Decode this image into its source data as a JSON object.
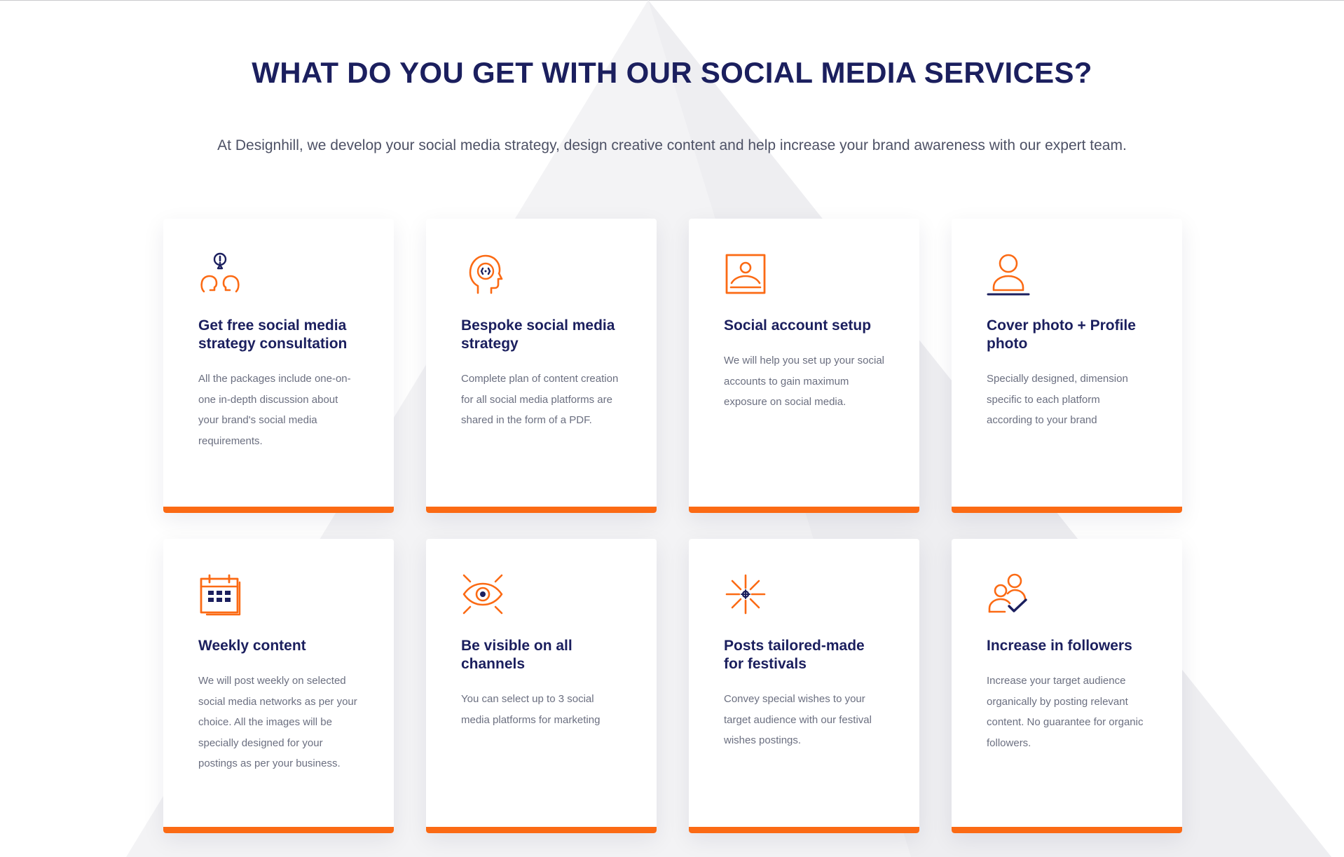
{
  "section": {
    "title": "WHAT DO YOU GET WITH OUR SOCIAL MEDIA SERVICES?",
    "subtitle": "At Designhill, we develop your social media strategy, design creative content and help increase your brand awareness with our expert team."
  },
  "colors": {
    "navy": "#1b1f5e",
    "orange": "#fb6a14",
    "body_text": "#6b6f80"
  },
  "cards": [
    {
      "icon": "consultation-heads-icon",
      "title": "Get free social media strategy consultation",
      "text": "All the packages include one-on-one in-depth discussion about your brand's social media requirements."
    },
    {
      "icon": "head-strategy-icon",
      "title": "Bespoke social media strategy",
      "text": "Complete plan of content creation for all social media platforms are shared in the form of a PDF."
    },
    {
      "icon": "profile-frame-icon",
      "title": "Social account setup",
      "text": "We will help you set up your social accounts to gain maximum exposure on social media."
    },
    {
      "icon": "user-profile-icon",
      "title": "Cover photo + Profile photo",
      "text": "Specially designed, dimension specific to each platform according to your brand"
    },
    {
      "icon": "calendar-icon",
      "title": "Weekly content",
      "text": "We will post weekly on selected social media networks as per your choice. All the images will be specially designed for your postings as per your business."
    },
    {
      "icon": "eye-icon",
      "title": "Be visible on all channels",
      "text": "You can select up to 3 social media platforms for marketing"
    },
    {
      "icon": "firework-icon",
      "title": "Posts tailored-made for festivals",
      "text": "Convey special wishes to your target audience with our festival wishes postings."
    },
    {
      "icon": "followers-check-icon",
      "title": "Increase in followers",
      "text": "Increase your target audience organically by posting relevant content. No guarantee for organic followers."
    }
  ]
}
